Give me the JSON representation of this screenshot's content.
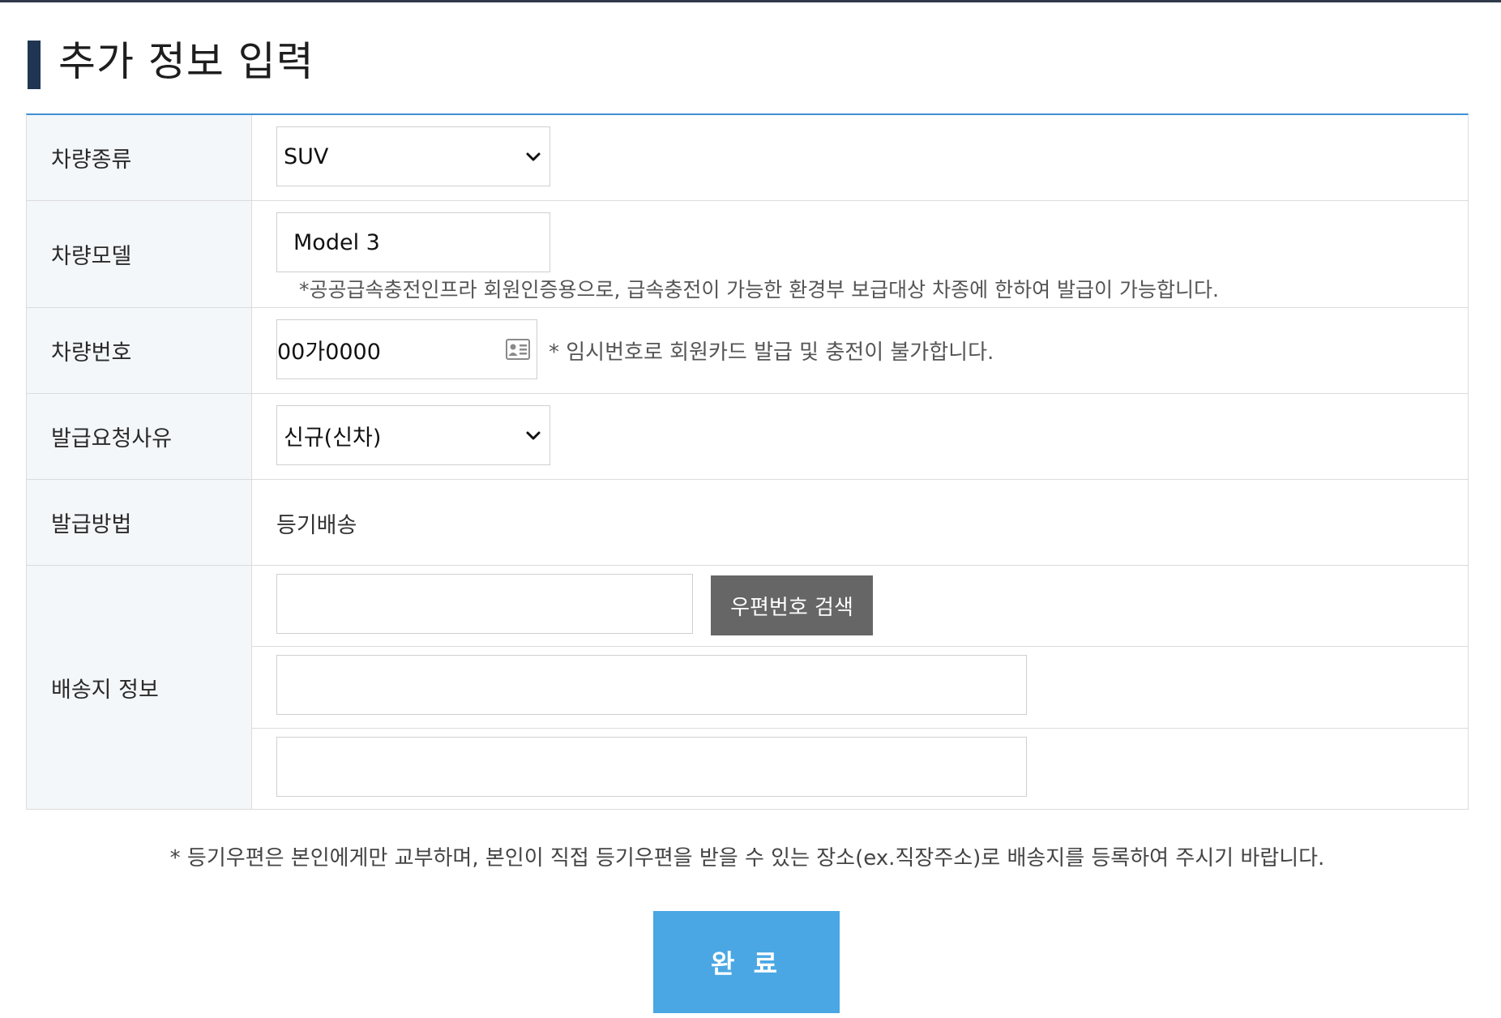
{
  "page": {
    "title": "추가 정보 입력"
  },
  "form": {
    "vehicle_type": {
      "label": "차량종류",
      "selected": "SUV"
    },
    "vehicle_model": {
      "label": "차량모델",
      "value": "Model 3",
      "note": "*공공급속충전인프라 회원인증용으로, 급속충전이 가능한 환경부 보급대상 차종에 한하여 발급이 가능합니다."
    },
    "vehicle_number": {
      "label": "차량번호",
      "value": "00가0000",
      "icon": "id-card-icon",
      "note": "* 임시번호로 회원카드 발급 및 충전이 불가합니다."
    },
    "issue_reason": {
      "label": "발급요청사유",
      "selected": "신규(신차)"
    },
    "issue_method": {
      "label": "발급방법",
      "value": "등기배송"
    },
    "delivery": {
      "label": "배송지 정보",
      "zip_value": "",
      "zip_button": "우편번호 검색",
      "address1": "",
      "address2": ""
    }
  },
  "notice": "* 등기우편은 본인에게만 교부하며, 본인이 직접 등기우편을 받을 수 있는 장소(ex.직장주소)로 배송지를 등록하여 주시기 바랍니다.",
  "submit_label": "완 료",
  "colors": {
    "accent_line": "#3f8fd6",
    "title_bar": "#1f3552",
    "label_bg": "#f4f7fa",
    "zip_button": "#666666",
    "submit_button": "#4aa7e4"
  }
}
